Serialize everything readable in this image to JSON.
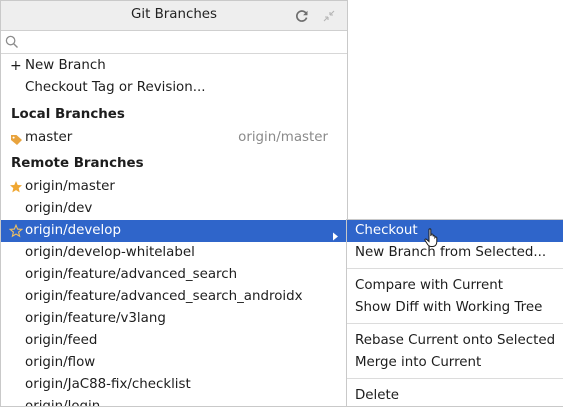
{
  "popup": {
    "title": "Git Branches",
    "search": {
      "value": "",
      "placeholder": ""
    },
    "actions": [
      {
        "label": "New Branch",
        "prefix": "+"
      },
      {
        "label": "Checkout Tag or Revision..."
      }
    ],
    "local_section": "Local Branches",
    "local_branches": [
      {
        "name": "master",
        "tracking": "origin/master",
        "icon": "tag-icon"
      }
    ],
    "remote_section": "Remote Branches",
    "remote_branches": [
      {
        "name": "origin/master",
        "icon": "star-filled-icon"
      },
      {
        "name": "origin/dev"
      },
      {
        "name": "origin/develop",
        "icon": "star-outline-icon",
        "selected": true
      },
      {
        "name": "origin/develop-whitelabel"
      },
      {
        "name": "origin/feature/advanced_search"
      },
      {
        "name": "origin/feature/advanced_search_androidx"
      },
      {
        "name": "origin/feature/v3lang"
      },
      {
        "name": "origin/feed"
      },
      {
        "name": "origin/flow"
      },
      {
        "name": "origin/JaC88-fix/checklist"
      },
      {
        "name": "origin/login"
      }
    ]
  },
  "submenu": {
    "items": [
      {
        "label": "Checkout",
        "selected": true
      },
      {
        "label": "New Branch from Selected..."
      },
      {
        "label": "Compare with Current"
      },
      {
        "label": "Show Diff with Working Tree"
      },
      {
        "label": "Rebase Current onto Selected"
      },
      {
        "label": "Merge into Current"
      },
      {
        "label": "Delete"
      }
    ]
  },
  "colors": {
    "selection": "#2f65ca",
    "header_bg": "#eeeeee",
    "star": "#f0a732",
    "tag": "#e8a33d",
    "tracking_text": "#8a8a8a"
  }
}
